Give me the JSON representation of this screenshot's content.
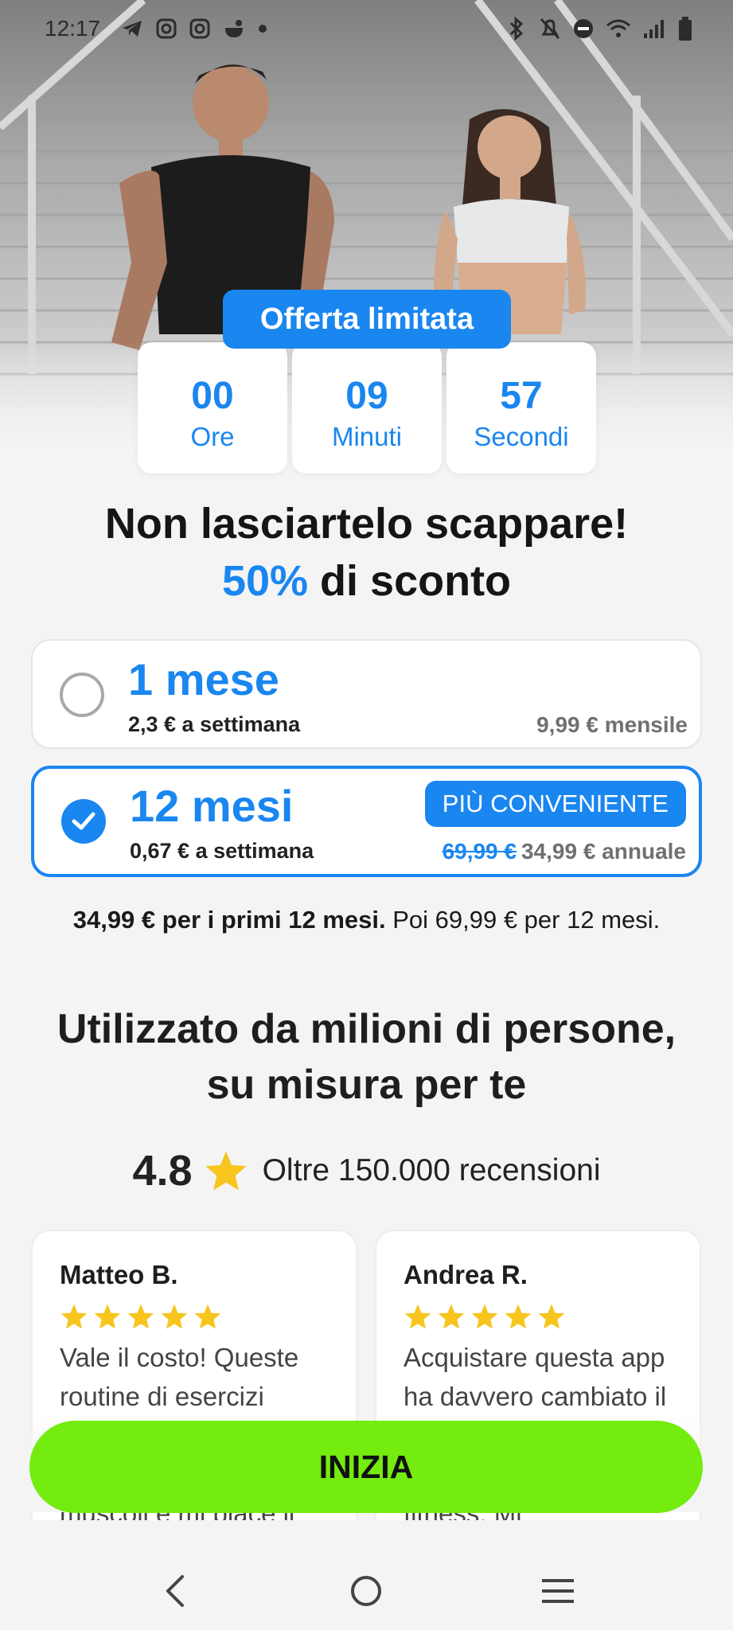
{
  "status_bar": {
    "time": "12:17",
    "left_icons": [
      "telegram-icon",
      "instagram-icon",
      "instagram-icon",
      "app-icon",
      "dot-icon"
    ],
    "right_icons": [
      "bluetooth-icon",
      "mute-icon",
      "dnd-icon",
      "wifi-icon",
      "signal-icon",
      "battery-icon"
    ]
  },
  "offer": {
    "badge": "Offerta limitata",
    "timer": [
      {
        "value": "00",
        "unit": "Ore"
      },
      {
        "value": "09",
        "unit": "Minuti"
      },
      {
        "value": "57",
        "unit": "Secondi"
      }
    ]
  },
  "headline": {
    "line1": "Non lasciartelo scappare!",
    "percent": "50%",
    "rest": " di sconto"
  },
  "plans": [
    {
      "name": "1 mese",
      "weekly": "2,3 € a settimana",
      "price": "9,99 € mensile",
      "selected": false
    },
    {
      "name": "12 mesi",
      "weekly": "0,67 € a settimana",
      "old_price": "69,99 €",
      "price": "34,99 € annuale",
      "badge": "PIÙ CONVENIENTE",
      "selected": true
    }
  ],
  "terms": {
    "bold": "34,99 € per i primi 12 mesi.",
    "normal": " Poi 69,99 € per 12 mesi."
  },
  "social_proof": {
    "title_line1": "Utilizzato da milioni di persone,",
    "title_line2": "su misura per te",
    "rating": "4.8",
    "reviews_count": "Oltre 150.000 recensioni"
  },
  "reviews": [
    {
      "name": "Matteo B.",
      "stars": 5,
      "text": "Vale il costo! Queste routine di esercizi hanno davvero rafforzato i miei muscoli e mi piace il"
    },
    {
      "name": "Andrea R.",
      "stars": 5,
      "text": "Acquistare questa app ha davvero cambiato il mio stile di vita. È la migliore app per il fitness. Mi"
    }
  ],
  "cta": "INIZIA",
  "colors": {
    "accent": "#1a86f0",
    "cta": "#74ec0f",
    "star": "#f7c51d",
    "background": "#f4f4f5"
  }
}
